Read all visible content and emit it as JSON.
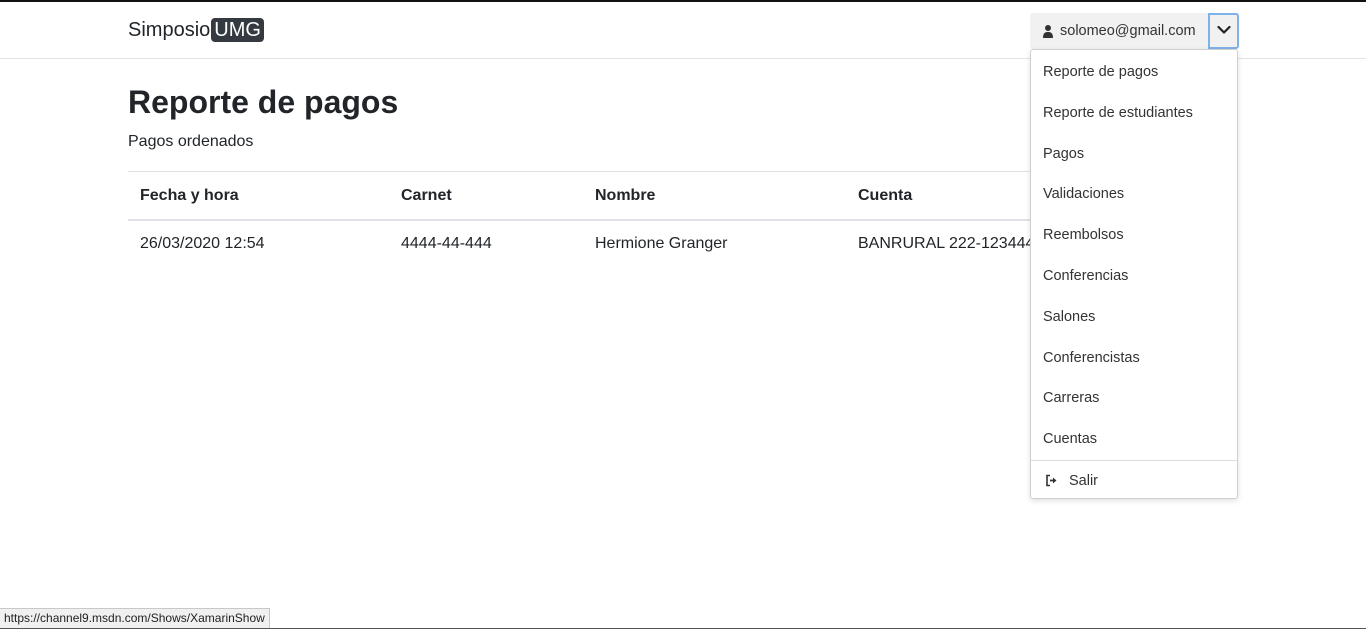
{
  "navbar": {
    "brand_text": "Simposio",
    "brand_badge": "UMG",
    "user_email": "solomeo@gmail.com",
    "user_icon": "user-icon",
    "toggle_icon": "chevron-down-icon"
  },
  "dropdown": {
    "items": [
      "Reporte de pagos",
      "Reporte de estudiantes",
      "Pagos",
      "Validaciones",
      "Reembolsos",
      "Conferencias",
      "Salones",
      "Conferencistas",
      "Carreras",
      "Cuentas"
    ],
    "logout_label": "Salir",
    "logout_icon": "sign-out-icon"
  },
  "page": {
    "title": "Reporte de pagos",
    "subtitle": "Pagos ordenados"
  },
  "table": {
    "headers": [
      "Fecha y hora",
      "Carnet",
      "Nombre",
      "Cuenta"
    ],
    "rows": [
      [
        "26/03/2020 12:54",
        "4444-44-444",
        "Hermione Granger",
        "BANRURAL 222-1234441"
      ]
    ]
  },
  "status_bar": {
    "url": "https://channel9.msdn.com/Shows/XamarinShow"
  }
}
